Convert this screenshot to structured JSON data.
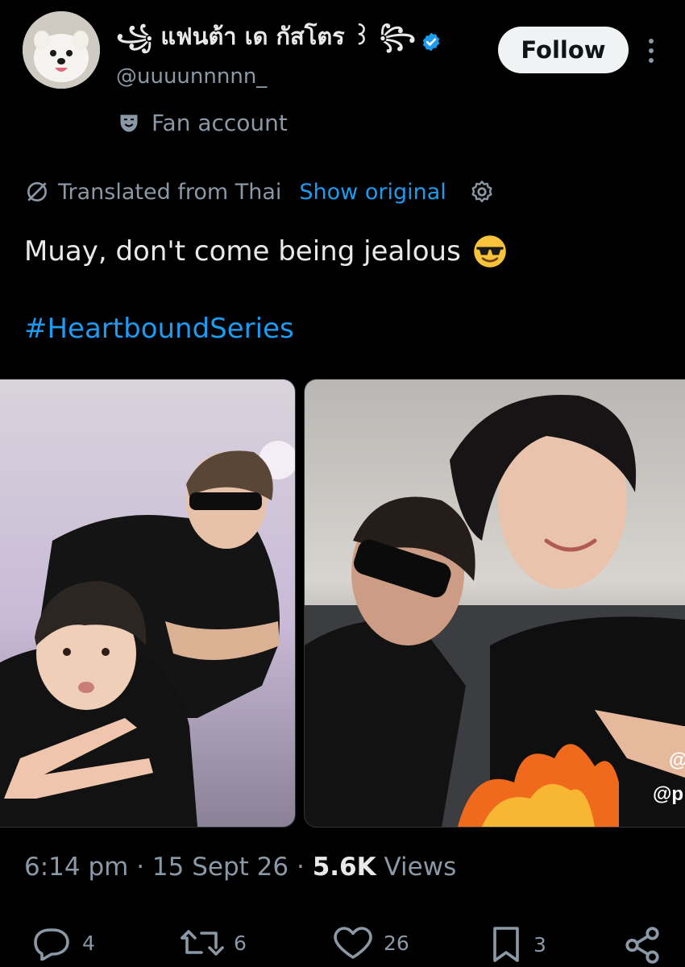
{
  "user": {
    "display_name": "꧁ แฟนต้า เด กัสโตร ꒱ ꧂",
    "handle": "@uuuunnnnn_",
    "label": "Fan account",
    "verified": true
  },
  "follow_label": "Follow",
  "translation": {
    "notice": "Translated from Thai",
    "show_original": "Show original"
  },
  "tweet": {
    "text": "Muay, don't come being jealous",
    "emoji": "smiling-face-with-sunglasses",
    "hashtag": "#HeartboundSeries"
  },
  "media": {
    "photo1_alt": "Two young men in black t-shirts, one wearing sunglasses, posing with peace sign",
    "photo2_alt": "Two young men lying on floor, one in sunglasses, one smiling with peace sign",
    "photo2_overlay_text": [
      "@",
      "@p"
    ]
  },
  "meta": {
    "time": "6:14 pm",
    "date": "15 Sept 26",
    "views_count": "5.6K",
    "views_label": "Views"
  },
  "actions": {
    "replies": "4",
    "reposts": "6",
    "likes": "26",
    "bookmarks": "3"
  },
  "colors": {
    "background": "#000000",
    "text": "#e7e9ea",
    "secondary": "#8b98a5",
    "accent": "#1d9bf0"
  }
}
